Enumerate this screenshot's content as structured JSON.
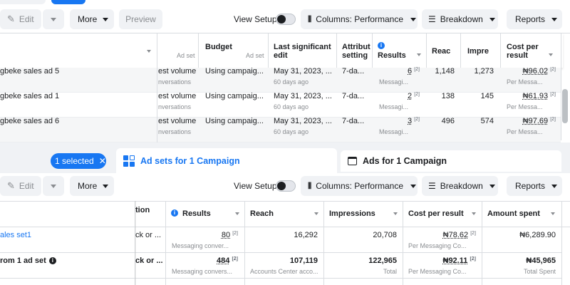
{
  "top": {
    "edit_label": "Edit",
    "more_label": "More",
    "preview_label": "Preview",
    "view_setup_label": "View Setup",
    "columns_label": "Columns: Performance",
    "breakdown_label": "Breakdown",
    "reports_label": "Reports",
    "headers": {
      "ad_set": "Ad set",
      "budget": "Budget",
      "budget_sub": "Ad set",
      "last_edit": "Last significant edit",
      "attribution": "Attribution setting",
      "results": "Results",
      "reach": "Reach",
      "impressions": "Impressions",
      "cost": "Cost per result"
    },
    "rows": [
      {
        "name": "gbeke sales ad 5",
        "adset": "est volume",
        "adset_sub": "nversations",
        "budget": "Using campaig...",
        "edit": "May 31, 2023, ...",
        "edit_sub": "60 days ago",
        "attr": "7-da...",
        "results": "6",
        "results_sub": "Messagi...",
        "reach": "1,148",
        "impressions": "1,273",
        "cost": "₦96.02",
        "cost_sub": "Per Messa..."
      },
      {
        "name": "gbeke sales ad 1",
        "adset": "est volume",
        "adset_sub": "nversations",
        "budget": "Using campaig...",
        "edit": "May 31, 2023, ...",
        "edit_sub": "60 days ago",
        "attr": "7-da...",
        "results": "2",
        "results_sub": "Messagi...",
        "reach": "138",
        "impressions": "145",
        "cost": "₦61.93",
        "cost_sub": "Per Messa..."
      },
      {
        "name": "gbeke sales ad 6",
        "adset": "est volume",
        "adset_sub": "nversations",
        "budget": "Using campaig...",
        "edit": "May 31, 2023, ...",
        "edit_sub": "60 days ago",
        "attr": "7-da...",
        "results": "3",
        "results_sub": "Messagi...",
        "reach": "496",
        "impressions": "574",
        "cost": "₦97.69",
        "cost_sub": "Per Messa..."
      }
    ]
  },
  "nav": {
    "selected_label": "1 selected",
    "adsets_tab": "Ad sets for 1 Campaign",
    "ads_tab": "Ads for 1 Campaign"
  },
  "bottom": {
    "edit_label": "Edit",
    "more_label": "More",
    "view_setup_label": "View Setup",
    "columns_label": "Columns: Performance",
    "breakdown_label": "Breakdown",
    "reports_label": "Reports",
    "headers": {
      "col2": "tion",
      "results": "Results",
      "reach": "Reach",
      "impressions": "Impressions",
      "cost": "Cost per result",
      "spent": "Amount spent"
    },
    "rows": [
      {
        "name": "ales set1",
        "col2": "ck or ...",
        "results": "80",
        "results_sub": "Messaging conver...",
        "reach": "16,292",
        "reach_sub": "",
        "impressions": "20,708",
        "impressions_sub": "",
        "cost": "₦78.62",
        "cost_sub": "Per Messaging Co...",
        "spent": "₦6,289.90",
        "spent_sub": ""
      },
      {
        "name": "rom 1 ad set",
        "col2": "ck or ...",
        "results": "484",
        "results_sub": "Messaging convers...",
        "reach": "107,119",
        "reach_sub": "Accounts Center acco...",
        "impressions": "122,965",
        "impressions_sub": "Total",
        "cost": "₦92.11",
        "cost_sub": "Per Messaging Co...",
        "spent": "₦45,965",
        "spent_sub": "Total Spent"
      }
    ]
  },
  "colors": {
    "accent": "#1877f2",
    "border": "#dadde1",
    "button_bg": "#f0f2f5"
  }
}
